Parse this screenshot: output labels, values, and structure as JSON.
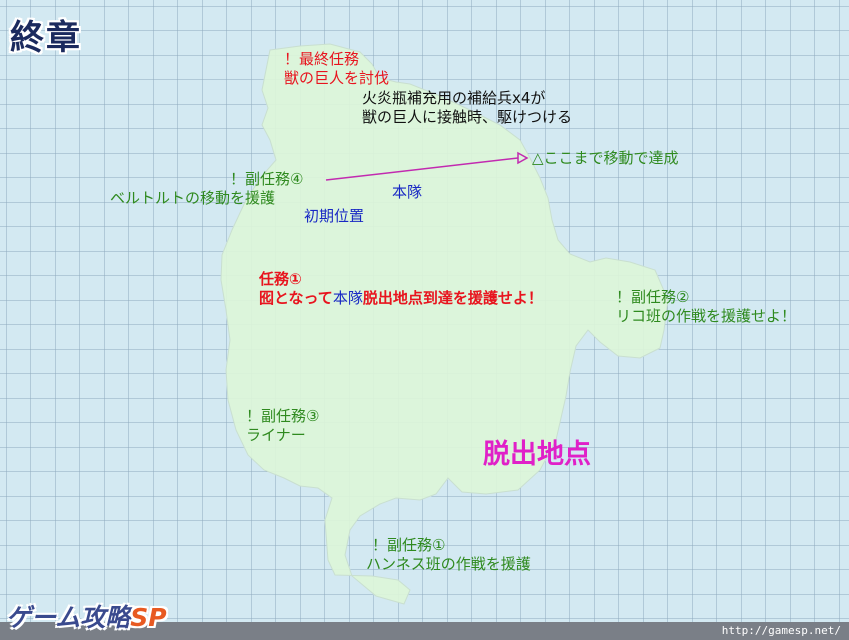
{
  "title": "終章",
  "colors": {
    "sea": "#d3e9f2",
    "grid": "#8ea9bd",
    "land": "#dcf5d9",
    "red": "#e8141e",
    "green": "#2f8a1f",
    "blue": "#1828c4",
    "magenta": "#e020c8"
  },
  "labels": {
    "final_mission_line1": "！最終任務",
    "final_mission_line2": "獣の巨人を討伐",
    "supply_line1": "火炎瓶補充用の補給兵x4が",
    "supply_line2": "獣の巨人に接触時、駆けつける",
    "achieve": "△ここまで移動で達成",
    "sub4_line1": "！副任務④",
    "sub4_line2": "ベルトルトの移動を援護",
    "honbu": "本隊",
    "initial_position": "初期位置",
    "mission1_line1": "任務①",
    "mission1_prefix": "囮となって",
    "mission1_honbu": "本隊",
    "mission1_suffix": "脱出地点到達を援護せよ！",
    "sub2_line1": "！副任務②",
    "sub2_line2": "リコ班の作戦を援護せよ！",
    "sub3_line1": "！副任務③",
    "sub3_line2": "ライナー",
    "exit_point": "脱出地点",
    "sub1_line1": "！副任務①",
    "sub1_line2": "ハンネス班の作戦を援護"
  },
  "logo": {
    "text": "ゲーム攻略",
    "suffix": "SP"
  },
  "site_url": "http://gamesp.net/"
}
